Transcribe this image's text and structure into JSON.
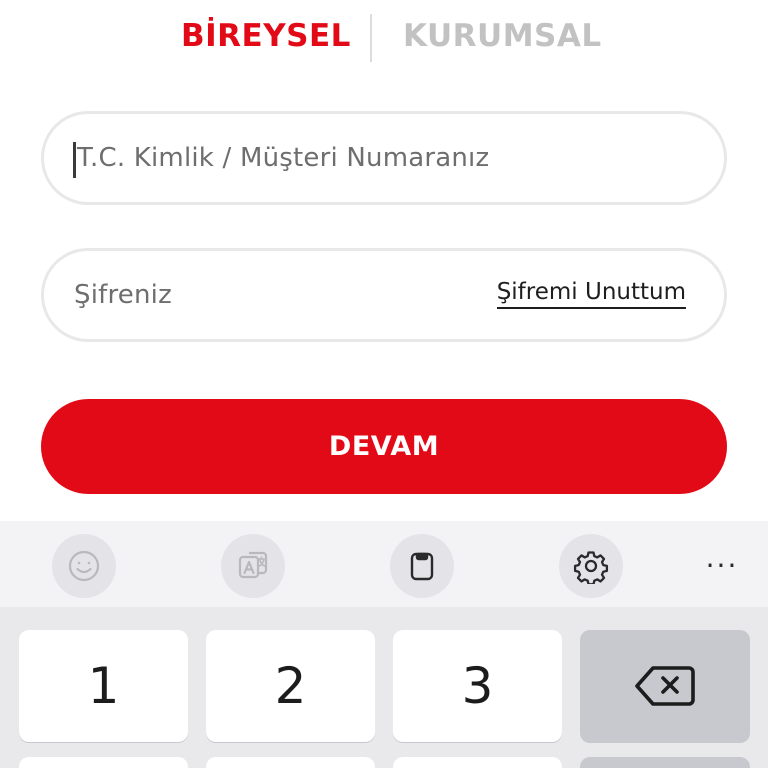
{
  "tabs": {
    "personal": "BİREYSEL",
    "corporate": "KURUMSAL"
  },
  "form": {
    "id_placeholder": "T.C. Kimlik / Müşteri Numaranız",
    "password_placeholder": "Şifreniz",
    "forgot_password": "Şifremi Unuttum",
    "continue_label": "DEVAM"
  },
  "keyboard": {
    "toolbar_icons": [
      "emoji-icon",
      "translate-icon",
      "clipboard-icon",
      "settings-icon",
      "more-icon"
    ],
    "more_label": "···",
    "keys": [
      "1",
      "2",
      "3"
    ],
    "backspace_icon": "backspace-icon"
  },
  "colors": {
    "brand_red": "#e30a17",
    "inactive_tab": "#c2c2c2"
  }
}
